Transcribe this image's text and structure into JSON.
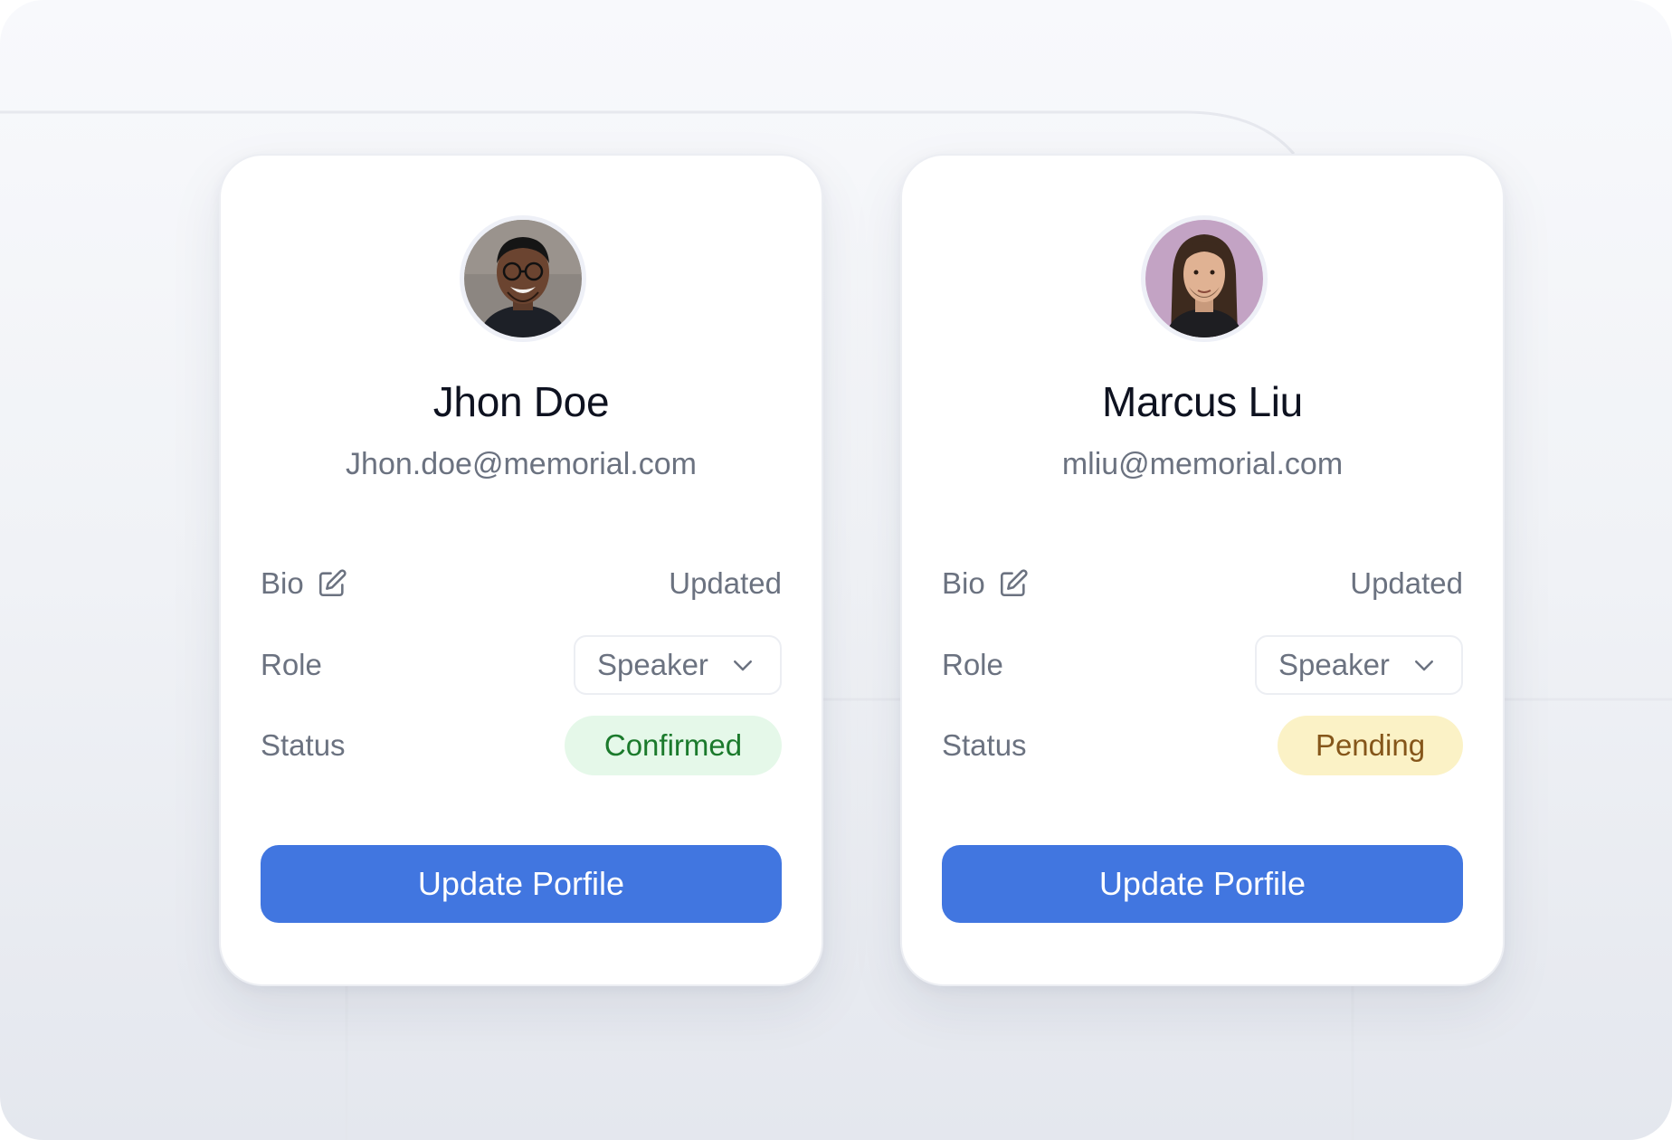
{
  "colors": {
    "primary_button": "#4176e0",
    "confirmed_bg": "#e5f8e9",
    "confirmed_text": "#1b7a2c",
    "pending_bg": "#fbf2c6",
    "pending_text": "#85561a"
  },
  "cards": [
    {
      "name": "Jhon Doe",
      "email": "Jhon.doe@memorial.com",
      "avatar_icon": "avatar-photo",
      "bio_label": "Bio",
      "bio_icon": "edit-icon",
      "bio_value": "Updated",
      "role_label": "Role",
      "role_value": "Speaker",
      "role_icon": "chevron-down-icon",
      "status_label": "Status",
      "status_value": "Confirmed",
      "button_label": "Update Porfile"
    },
    {
      "name": "Marcus Liu",
      "email": "mliu@memorial.com",
      "avatar_icon": "avatar-photo",
      "bio_label": "Bio",
      "bio_icon": "edit-icon",
      "bio_value": "Updated",
      "role_label": "Role",
      "role_value": "Speaker",
      "role_icon": "chevron-down-icon",
      "status_label": "Status",
      "status_value": "Pending",
      "button_label": "Update Porfile"
    }
  ]
}
